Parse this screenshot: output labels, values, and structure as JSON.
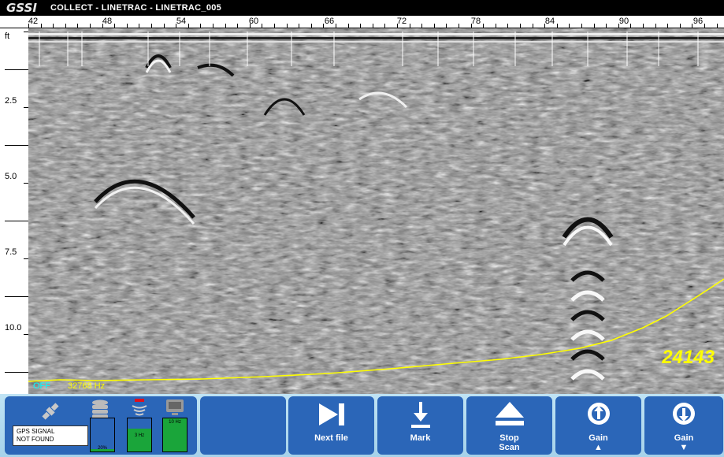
{
  "titlebar": {
    "logo": "GSSI",
    "title": "COLLECT - LINETRAC - LINETRAC_005"
  },
  "ruler": {
    "labels": [
      "42",
      "48",
      "54",
      "60",
      "66",
      "72",
      "78",
      "84",
      "90",
      "96"
    ]
  },
  "depth_axis": {
    "unit": "ft",
    "labels": [
      "2.5",
      "5.0",
      "7.5",
      "10.0"
    ]
  },
  "overlay": {
    "status": "OFF",
    "frequency": "32768 Hz",
    "count": "24143"
  },
  "status_panel": {
    "gps_message_line1": "GPS SIGNAL",
    "gps_message_line2": "NOT FOUND",
    "storage_meter_text": "20%",
    "signal_meter_text": "3 Hz",
    "battery_meter_text": "10 Hz",
    "storage_level": 0.08,
    "signal_level": 0.7,
    "battery_level": 1.0
  },
  "buttons": {
    "next_file": "Next file",
    "mark": "Mark",
    "stop_line1": "Stop",
    "stop_line2": "Scan",
    "gain_up": "Gain",
    "gain_up_arrow": "▲",
    "gain_down": "Gain",
    "gain_down_arrow": "▼"
  },
  "colors": {
    "button_blue": "#2b66b8",
    "toolbar_bg": "#bfe3f4",
    "overlay_yellow": "#ffff00",
    "status_cyan": "#00ffff",
    "meter_green": "#1aa53a"
  }
}
